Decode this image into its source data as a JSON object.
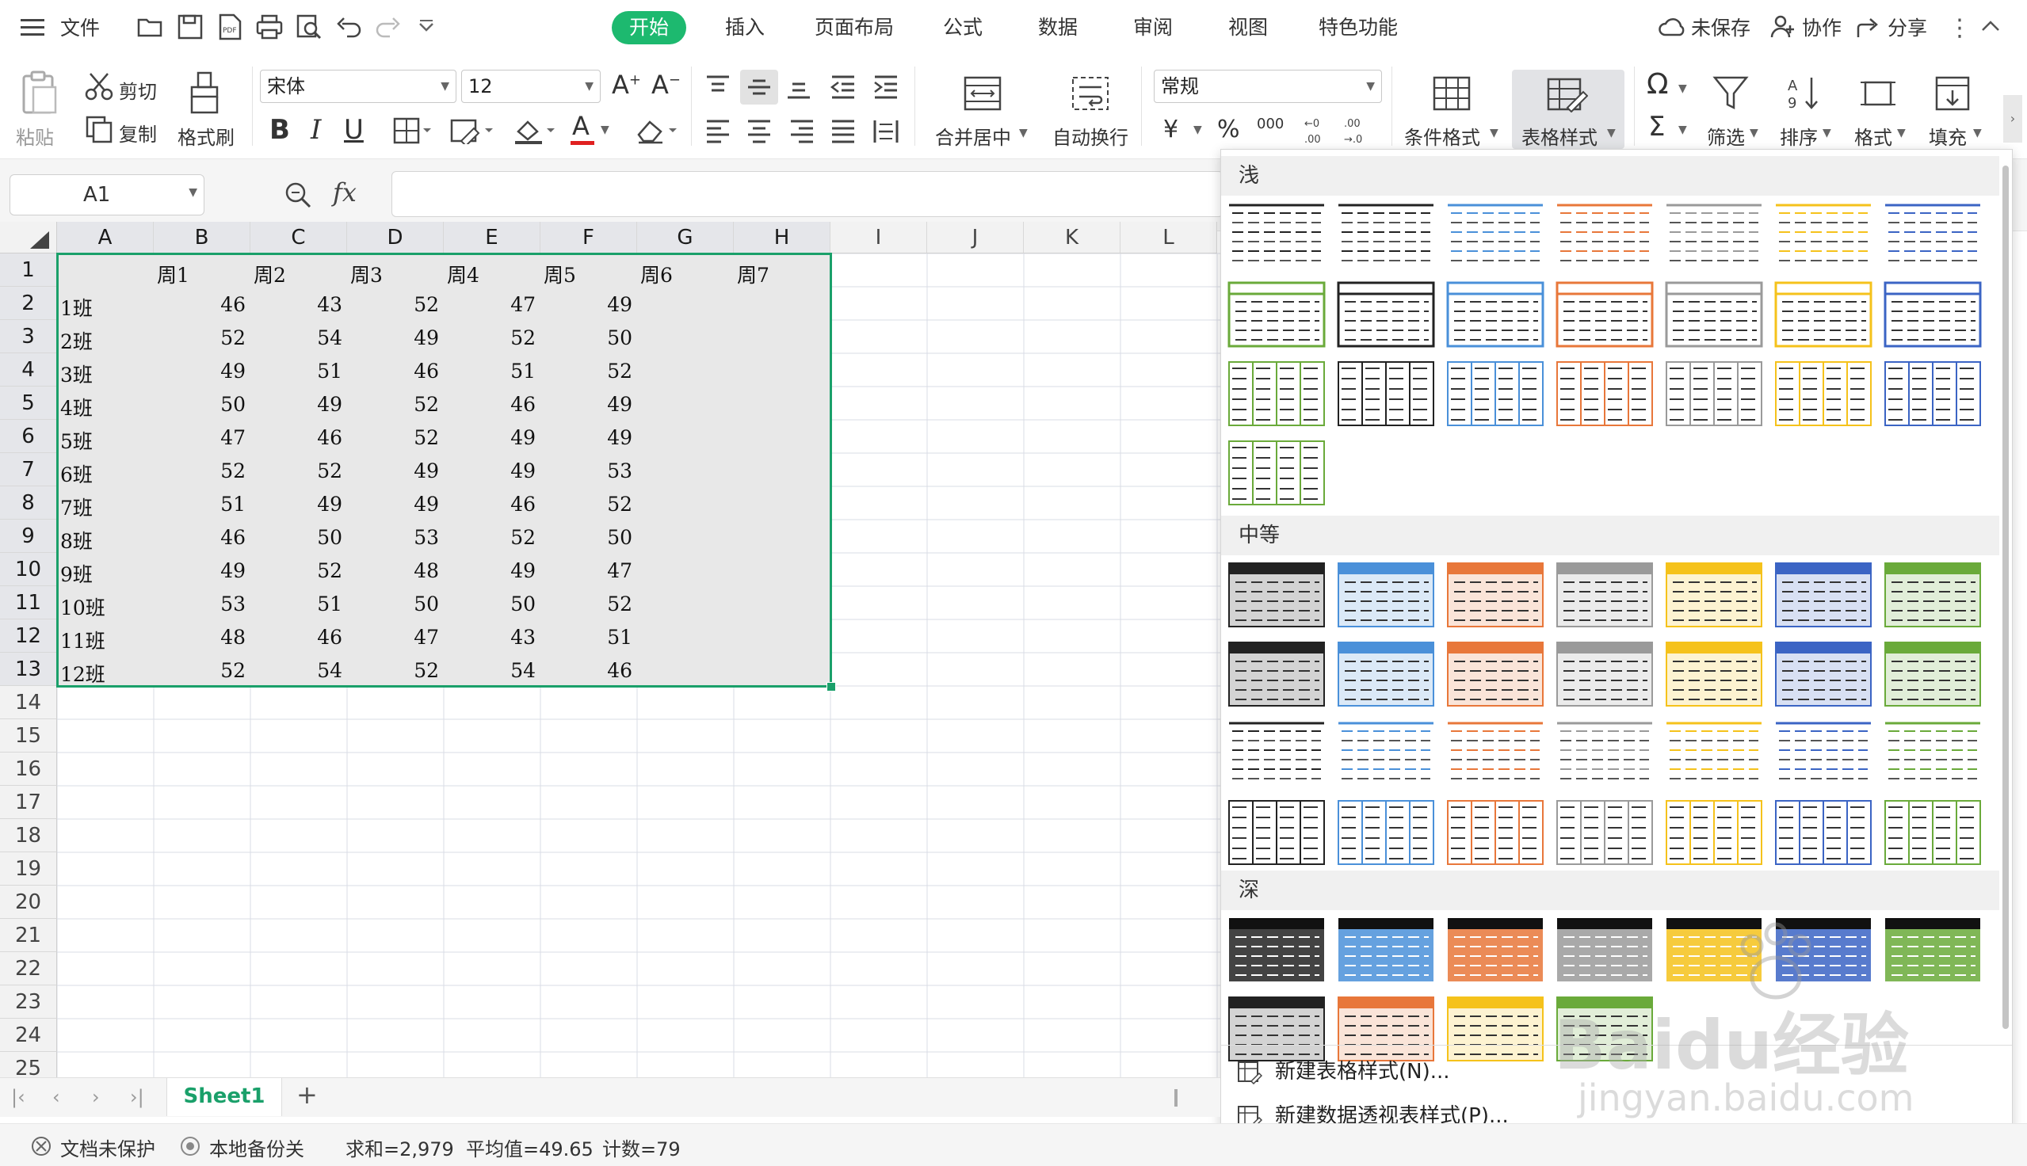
{
  "menu": {
    "file_label": "文件",
    "tabs": [
      {
        "label": "开始",
        "active": true
      },
      {
        "label": "插入"
      },
      {
        "label": "页面布局"
      },
      {
        "label": "公式"
      },
      {
        "label": "数据"
      },
      {
        "label": "审阅"
      },
      {
        "label": "视图"
      },
      {
        "label": "特色功能"
      }
    ],
    "unsaved": "未保存",
    "collab": "协作",
    "share": "分享"
  },
  "ribbon": {
    "paste": "粘贴",
    "cut": "剪切",
    "copy": "复制",
    "format_painter": "格式刷",
    "font_name": "宋体",
    "font_size": "12",
    "merge_center": "合并居中",
    "wrap_text": "自动换行",
    "number_format": "常规",
    "conditional_format": "条件格式",
    "table_style": "表格样式",
    "filter": "筛选",
    "sort": "排序",
    "format": "格式",
    "fill": "填充",
    "percent": "%",
    "thousands": "000",
    "currency": "¥"
  },
  "formula_bar": {
    "name_box": "A1",
    "fx": "fx"
  },
  "grid": {
    "columns": [
      "A",
      "B",
      "C",
      "D",
      "E",
      "F",
      "G",
      "H",
      "I",
      "J",
      "K",
      "L"
    ],
    "row_numbers": [
      "1",
      "2",
      "3",
      "4",
      "5",
      "6",
      "7",
      "8",
      "9",
      "10",
      "11",
      "12",
      "13",
      "14",
      "15",
      "16",
      "17",
      "18",
      "19",
      "20",
      "21",
      "22",
      "23",
      "24",
      "25"
    ],
    "header_row": [
      "",
      "周1",
      "周2",
      "周3",
      "周4",
      "周5",
      "周6",
      "周7"
    ],
    "rows": [
      [
        "1班",
        "46",
        "43",
        "52",
        "47",
        "49"
      ],
      [
        "2班",
        "52",
        "54",
        "49",
        "52",
        "50"
      ],
      [
        "3班",
        "49",
        "51",
        "46",
        "51",
        "52"
      ],
      [
        "4班",
        "50",
        "49",
        "52",
        "46",
        "49"
      ],
      [
        "5班",
        "47",
        "46",
        "52",
        "49",
        "49"
      ],
      [
        "6班",
        "52",
        "52",
        "49",
        "49",
        "53"
      ],
      [
        "7班",
        "51",
        "49",
        "49",
        "46",
        "52"
      ],
      [
        "8班",
        "46",
        "50",
        "53",
        "52",
        "50"
      ],
      [
        "9班",
        "49",
        "52",
        "48",
        "49",
        "47"
      ],
      [
        "10班",
        "53",
        "51",
        "50",
        "50",
        "52"
      ],
      [
        "11班",
        "48",
        "46",
        "47",
        "43",
        "51"
      ],
      [
        "12班",
        "52",
        "54",
        "52",
        "54",
        "46"
      ]
    ]
  },
  "style_panel": {
    "section_light": "浅",
    "section_medium": "中等",
    "section_dark": "深",
    "new_table_style": "新建表格样式(N)...",
    "new_pivot_style": "新建数据透视表样式(P)...",
    "palette": [
      "#222222",
      "#4a90d9",
      "#e8773a",
      "#9a9a9a",
      "#f5c21b",
      "#3b64c4",
      "#6aaa3a"
    ]
  },
  "sheet_tabs": {
    "active": "Sheet1",
    "add": "+"
  },
  "status": {
    "doc_unprotected": "文档未保护",
    "local_backup": "本地备份关",
    "sum": "求和=2,979",
    "average": "平均值=49.65",
    "count": "计数=79"
  },
  "watermark": {
    "brand": "Baidu经验",
    "url": "jingyan.baidu.com"
  }
}
